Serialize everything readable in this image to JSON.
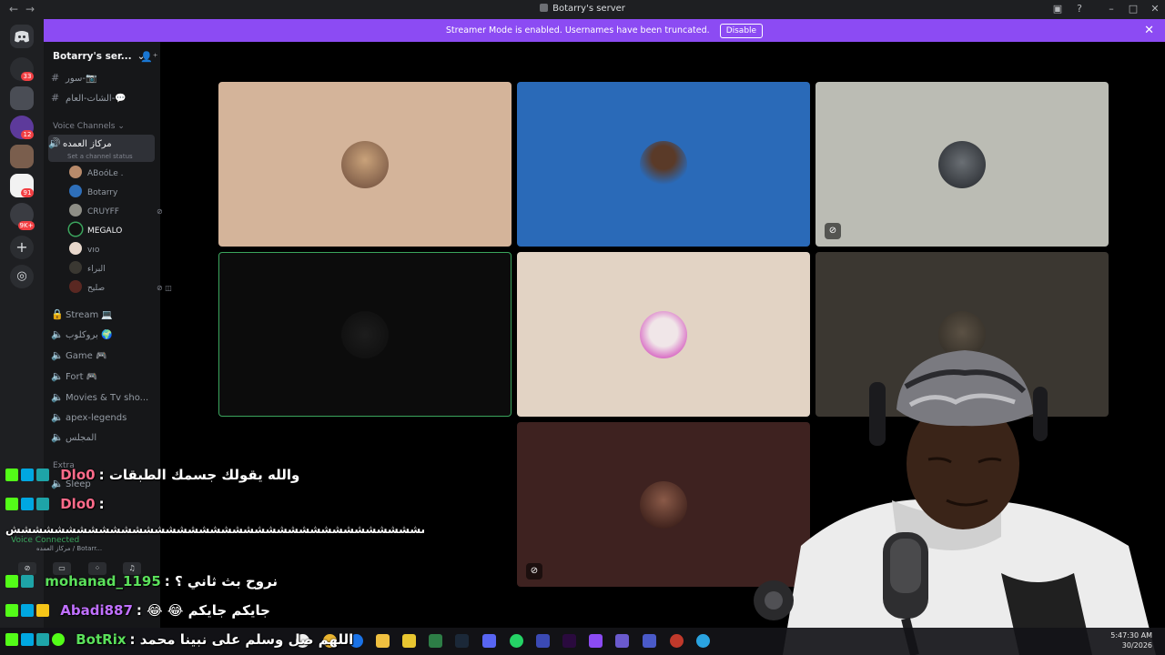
{
  "titlebar": {
    "title": "Botarry's server",
    "back": "←",
    "forward": "→"
  },
  "banner": {
    "text": "Streamer Mode is enabled. Usernames have been truncated.",
    "button": "Disable",
    "close": "✕"
  },
  "rail": {
    "badges": [
      "33",
      "12",
      "91",
      "9K+"
    ]
  },
  "sidebar": {
    "server_name": "Botarry's ser...",
    "channels_top": [
      {
        "name": "سور-📷"
      },
      {
        "name": "الشات-العام-💬"
      }
    ],
    "voice_category": "Voice Channels",
    "active_channel": {
      "name": "مركاز العمده",
      "status": "Set a channel status"
    },
    "members": [
      {
        "name": "ABoóLe ."
      },
      {
        "name": "Botarry"
      },
      {
        "name": "CRUYFF"
      },
      {
        "name": "MEGALO"
      },
      {
        "name": "vıo"
      },
      {
        "name": "البراء"
      },
      {
        "name": "صليح"
      }
    ],
    "voice_channels": [
      {
        "name": "Stream 💻"
      },
      {
        "name": "بروكلوب 🌍"
      },
      {
        "name": "Game 🎮"
      },
      {
        "name": "Fort 🎮"
      },
      {
        "name": "Movies & Tv sho..."
      },
      {
        "name": "apex-legends"
      },
      {
        "name": "المجلس"
      }
    ],
    "extra_category": "Extra",
    "sleep_channel": "Sleep",
    "voice_connected": "Voice Connected",
    "voice_location": "مركاز العمده / Botarr..."
  },
  "chat": [
    {
      "user": "Dlo0",
      "text": "والله يقولك جسمك الطبقات",
      "color": "#ff6b8a"
    },
    {
      "user": "Dlo0",
      "text": "",
      "color": "#ff6b8a"
    },
    {
      "user": "",
      "text": "ششششششششششششششششششششششششششششششششششششششششششششششششش",
      "color": "#ffffff"
    },
    {
      "user": "mohanad_1195",
      "text": "نروح بث ثاني ؟",
      "color": "#5be05b"
    },
    {
      "user": "Abadi887",
      "text": "😂 😂 جايكم جايكم",
      "color": "#c070ff"
    },
    {
      "user": "BotRix",
      "text": "اللهم صل وسلم على نبينا محمد",
      "color": "#5be05b"
    }
  ],
  "taskbar": {
    "time": "5:47:30 AM",
    "date": "30/2026"
  },
  "colors": {
    "accent": "#8c4bf3",
    "speaking": "#3ba55d"
  }
}
